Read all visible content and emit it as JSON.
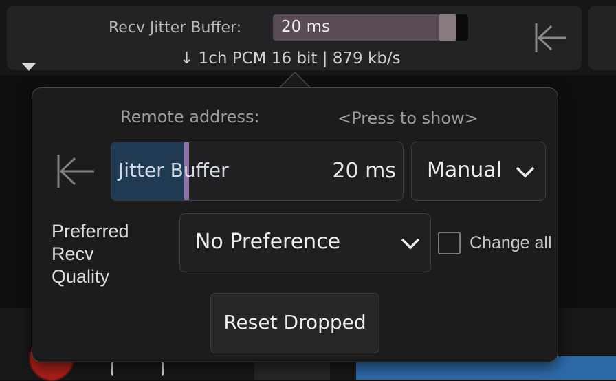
{
  "status_bar": {
    "jitter_label": "Recv Jitter Buffer:",
    "jitter_value": "20 ms",
    "jitter_level": 0.85,
    "codec_info": "↓ 1ch PCM 16 bit | 879 kb/s",
    "collapse_icon": "arrow-left-to-bar-icon",
    "menu_icon": "triangle-down-icon"
  },
  "popover": {
    "remote_address_label": "Remote address:",
    "remote_address_value": "<Press to show>",
    "collapse_icon": "arrow-left-to-bar-icon",
    "jitter_buffer": {
      "label": "Jitter Buffer",
      "value": "20 ms",
      "level": 0.25
    },
    "mode_select": {
      "selected": "Manual",
      "icon": "chevron-down-icon"
    },
    "preferred_quality": {
      "label_line1": "Preferred Recv",
      "label_line2": "Quality",
      "selected": "No Preference",
      "icon": "chevron-down-icon"
    },
    "change_all": {
      "label": "Change all",
      "checked": false
    },
    "reset_button_label": "Reset Dropped"
  },
  "colors": {
    "accent_fill": "#1f3a52",
    "marker": "#9070a8",
    "record": "#a8201a",
    "progress_blue": "#2e6aa8"
  }
}
